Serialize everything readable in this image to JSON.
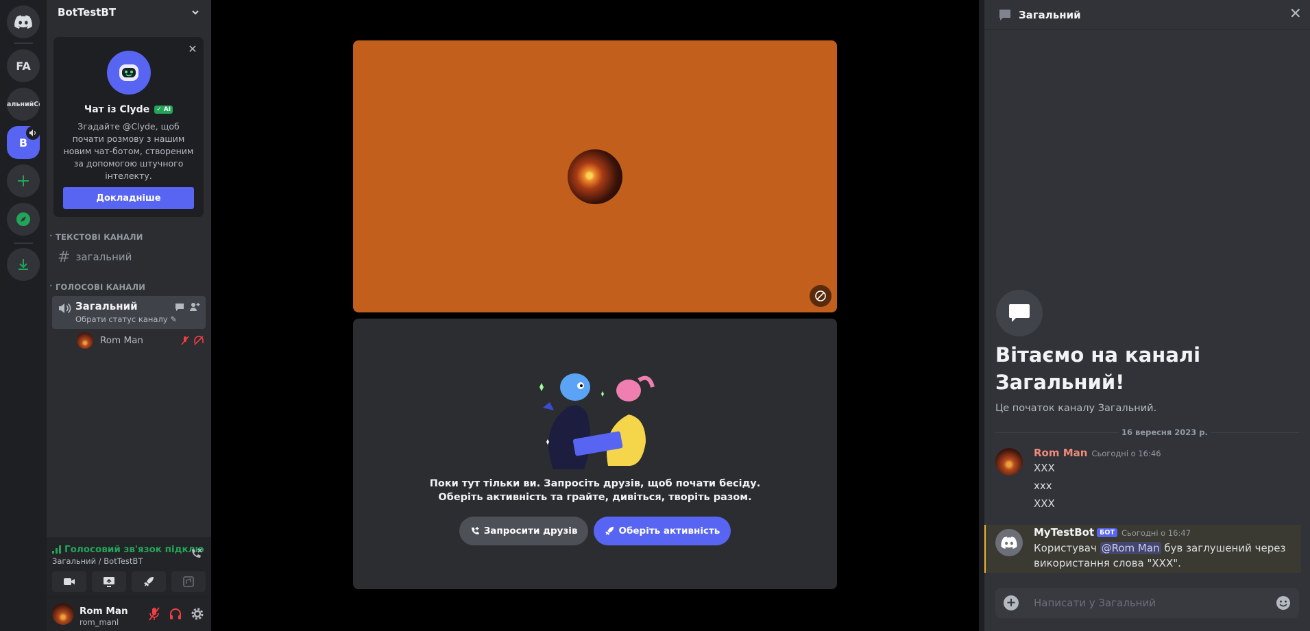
{
  "rail": {
    "servers": [
      {
        "label": "FA"
      },
      {
        "label": "альнийСер"
      },
      {
        "label": "B"
      }
    ]
  },
  "guild": {
    "name": "BotTestBT"
  },
  "clyde": {
    "title": "Чат із Clyde",
    "ai_badge": "✓ AI",
    "description": "Згадайте @Clyde, щоб почати розмову з нашим новим чат-ботом, створеним за допомогою штучного інтелекту.",
    "button": "Докладніше"
  },
  "channels": {
    "text_category": "ТЕКСТОВІ КАНАЛИ",
    "text_channel": "загальний",
    "voice_category": "ГОЛОСОВІ КАНАЛИ",
    "voice_channel": "Загальний",
    "voice_status": "Обрати статус каналу",
    "member": "Rom Man"
  },
  "voice_panel": {
    "status": "Голосовий зв'язок підклю",
    "sub": "Загальний / BotTestBT"
  },
  "user": {
    "name": "Rom Man",
    "tag": "rom_manl"
  },
  "stage": {
    "invite_line1": "Поки тут тільки ви. Запросіть друзів, щоб почати бесіду.",
    "invite_line2": "Оберіть активність та грайте, дивіться, творіть разом.",
    "invite_button": "Запросити друзів",
    "activity_button": "Оберіть активність"
  },
  "chat": {
    "title": "Загальний",
    "welcome_title": "Вітаємо на каналі Загальний!",
    "welcome_sub": "Це початок каналу Загальний.",
    "date_divider": "16 вересня 2023 р.",
    "messages": [
      {
        "author": "Rom Man",
        "time": "Сьогодні о 16:46",
        "lines": [
          "XXX",
          "xxx",
          "XXX"
        ]
      },
      {
        "author": "MyTestBot",
        "badge": "БОТ",
        "time": "Сьогодні о 16:47",
        "text_before": "Користувач ",
        "mention": "@Rom Man",
        "text_after": " був заглушений через",
        "line2": "використання слова \"XXX\"."
      }
    ],
    "composer_placeholder": "Написати у Загальний"
  },
  "colors": {
    "blurple": "#5865f2",
    "green": "#23a559",
    "tile_orange": "#c35f1c",
    "rom_name": "#f08a7a"
  }
}
